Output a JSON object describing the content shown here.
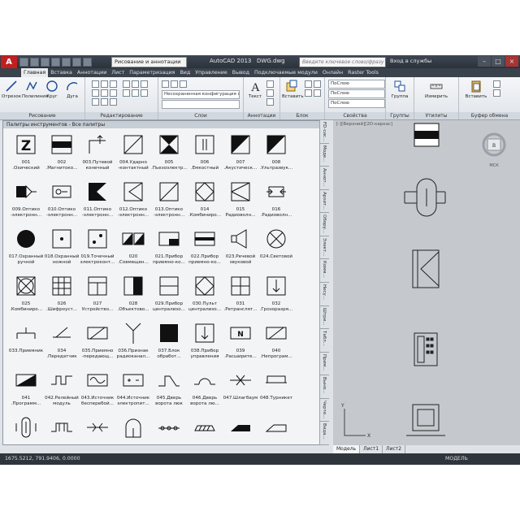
{
  "window": {
    "app_button": "A",
    "workspace": "Рисование и аннотации",
    "title": "AutoCAD 2013",
    "file": "DWG.dwg",
    "search_placeholder": "Введите ключевое слово/фразу",
    "signin": "Вход в службы"
  },
  "tabs": [
    "Главная",
    "Вставка",
    "Аннотации",
    "Лист",
    "Параметризация",
    "Вид",
    "Управление",
    "Вывод",
    "Подключаемые модули",
    "Онлайн",
    "Raster Tools"
  ],
  "ribbon": {
    "draw": {
      "title": "Рисование",
      "tools": [
        "Отрезок",
        "Полилиния",
        "Круг",
        "Дуга"
      ]
    },
    "modify": {
      "title": "Редактирование"
    },
    "layers": {
      "title": "Слои",
      "combo": "Несохраненная конфигурация сло"
    },
    "annotation": {
      "title": "Аннотации",
      "tool": "Текст"
    },
    "block": {
      "title": "Блок",
      "tool": "Вставить"
    },
    "properties": {
      "title": "Свойства",
      "combo1": "ПоСлою",
      "combo2": "ПоСлою",
      "combo3": "ПоСлою"
    },
    "groups": {
      "title": "Группы",
      "tool": "Группа"
    },
    "utilities": {
      "title": "Утилиты",
      "tool": "Измерить"
    },
    "clipboard": {
      "title": "Буфер обмена",
      "tool": "Вставить"
    }
  },
  "palette": {
    "header": "Палитры инструментов - Все палитры",
    "items": [
      {
        "icon": "z-letter-icon",
        "label": "001\n.Охический"
      },
      {
        "icon": "band-icon",
        "label": "002\n.Магнитоко..."
      },
      {
        "icon": "corner-icon",
        "label": "003.Путевой\nконечный"
      },
      {
        "icon": "diagonal-box-icon",
        "label": "004.Ударно\n-контактный"
      },
      {
        "icon": "bowtie-icon",
        "label": "005\n.Пьезоэлектр..."
      },
      {
        "icon": "capacitor-box-icon",
        "label": "006\n.Емкостный"
      },
      {
        "icon": "half-triangle-icon",
        "label": "007\n.Акустическ..."
      },
      {
        "icon": "half-triangle-icon",
        "label": "008\n.Ультразвук..."
      },
      {
        "icon": "emitter-icon",
        "label": "009.Оптико\n-электронн..."
      },
      {
        "icon": "receiver-icon",
        "label": "010.Оптико\n-электронн..."
      },
      {
        "icon": "filled-notch-icon",
        "label": "011.Оптико\n-электронн..."
      },
      {
        "icon": "notch-icon",
        "label": "012.Оптико\n-электронн..."
      },
      {
        "icon": "diagonal-box-icon",
        "label": "013.Оптико\n-электронн..."
      },
      {
        "icon": "diamond-box-icon",
        "label": "014\n.Комбиниро..."
      },
      {
        "icon": "fan-box-icon",
        "label": "015\nРадиоволн..."
      },
      {
        "icon": "arrows-icon",
        "label": "016\n.Радиоволн..."
      },
      {
        "icon": "filled-circle-icon",
        "label": "017.Охранный\nручной"
      },
      {
        "icon": "dot-box-icon",
        "label": "018.Охранный\nножной"
      },
      {
        "icon": "two-dots-box-icon",
        "label": "019.Точечный\nэлектроконт..."
      },
      {
        "icon": "tri-pair-icon",
        "label": "020\n.Совмещен..."
      },
      {
        "icon": "half-fill-box-icon",
        "label": "021.Прибор\nприемно-ко..."
      },
      {
        "icon": "bar-box-icon",
        "label": "022.Прибор\nприемно-ко..."
      },
      {
        "icon": "horn-icon",
        "label": "023.Речевой\nзвуковой"
      },
      {
        "icon": "x-circle-icon",
        "label": "024.Световой"
      },
      {
        "icon": "x-circle-box-icon",
        "label": "025\n.Комбиниро..."
      },
      {
        "icon": "grid-icon",
        "label": "026\n.Шифроуст..."
      },
      {
        "icon": "t-box-icon",
        "label": "027\nУстройство..."
      },
      {
        "icon": "half-black-box-icon",
        "label": "028\n.Объектово..."
      },
      {
        "icon": "line-box-icon",
        "label": "029.Прибор\nцентрализо..."
      },
      {
        "icon": "diamond-box-icon",
        "label": "030.Пульт\nцентрализо..."
      },
      {
        "icon": "cross-box-icon",
        "label": "031\n.Ретранслят..."
      },
      {
        "icon": "arrow-down-box-icon",
        "label": "032\n.Грозоразря..."
      },
      {
        "icon": "t-line-icon",
        "label": "033.Приемник"
      },
      {
        "icon": "slash-icon",
        "label": "034\n.Передатчик"
      },
      {
        "icon": "slash-box-icon",
        "label": "035.Приемно\n-передающ..."
      },
      {
        "icon": "antenna-icon",
        "label": "036.Признак\nрадиоканал..."
      },
      {
        "icon": "black-box-icon",
        "label": "037.Блок\nобработ..."
      },
      {
        "icon": "arrow-down-box-icon",
        "label": "038.Прибор\nуправления"
      },
      {
        "icon": "n-box-icon",
        "label": "039\n.Расширите..."
      },
      {
        "icon": "slash-box-icon",
        "label": "040\n.Непрограм..."
      },
      {
        "icon": "wedge-icon",
        "label": "041\n.Программ..."
      },
      {
        "icon": "wave-icon",
        "label": "042.Релейный\nмодуль"
      },
      {
        "icon": "sine-box-icon",
        "label": "043.Источник\nбесперебой..."
      },
      {
        "icon": "plus-minus-box-icon",
        "label": "044.Источник\nэлектропит..."
      },
      {
        "icon": "step-icon",
        "label": "045.Дверь\nворота люк"
      },
      {
        "icon": "curve-icon",
        "label": "046.Дверь\nворота лю..."
      },
      {
        "icon": "x-line-icon",
        "label": "047.Шлагбаум"
      },
      {
        "icon": "gate-icon",
        "label": "048.Турникет"
      },
      {
        "icon": "lock-icon",
        "label": ""
      },
      {
        "icon": "pulse-icon",
        "label": ""
      },
      {
        "icon": "diode-icon",
        "label": ""
      },
      {
        "icon": "arch-icon",
        "label": ""
      },
      {
        "icon": "fence-icon",
        "label": ""
      },
      {
        "icon": "hatched-bar-icon",
        "label": ""
      },
      {
        "icon": "black-wedge-icon",
        "label": ""
      },
      {
        "icon": "wedge-outline-icon",
        "label": ""
      }
    ],
    "side_tabs": [
      "FD-сис...",
      "Моде...",
      "Аннот...",
      "Архит...",
      "Обору...",
      "Элект...",
      "Комм...",
      "Несу...",
      "Штри...",
      "Табл...",
      "Прим...",
      "Выно...",
      "Черте...",
      "Вида..."
    ]
  },
  "drawing": {
    "viewport_label": "[-][Верхний][2D-каркас]",
    "compass": "В",
    "wcs": "МСК"
  },
  "layout_tabs": [
    "Модель",
    "Лист1",
    "Лист2"
  ],
  "status": {
    "coords": "1675.5212, 791.9406, 0.0000",
    "model": "МОДЕЛЬ"
  }
}
